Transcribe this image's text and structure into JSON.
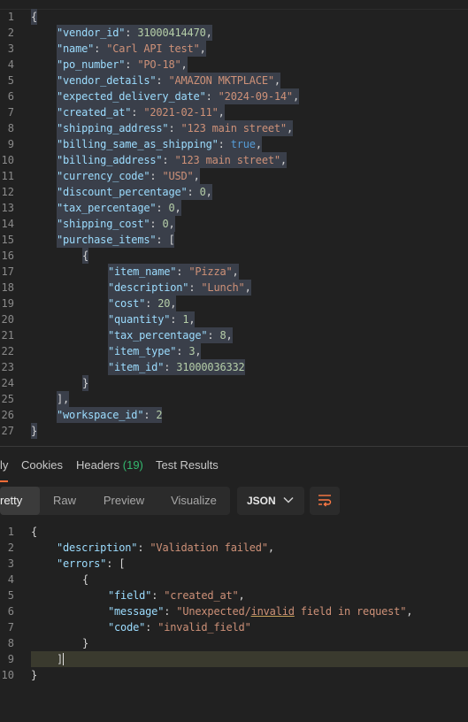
{
  "request_body": {
    "lines": [
      {
        "num": "1",
        "tokens": [
          [
            "p",
            "{"
          ]
        ]
      },
      {
        "num": "2",
        "tokens": [
          [
            "k",
            "\"vendor_id\""
          ],
          [
            "p",
            ": "
          ],
          [
            "n",
            "31000414470"
          ],
          [
            "p",
            ","
          ]
        ]
      },
      {
        "num": "3",
        "tokens": [
          [
            "k",
            "\"name\""
          ],
          [
            "p",
            ": "
          ],
          [
            "s",
            "\"Carl API test\""
          ],
          [
            "p",
            ","
          ]
        ]
      },
      {
        "num": "4",
        "tokens": [
          [
            "k",
            "\"po_number\""
          ],
          [
            "p",
            ": "
          ],
          [
            "s",
            "\"PO-18\""
          ],
          [
            "p",
            ","
          ]
        ]
      },
      {
        "num": "5",
        "tokens": [
          [
            "k",
            "\"vendor_details\""
          ],
          [
            "p",
            ": "
          ],
          [
            "s",
            "\"AMAZON MKTPLACE\""
          ],
          [
            "p",
            ","
          ]
        ]
      },
      {
        "num": "6",
        "tokens": [
          [
            "k",
            "\"expected_delivery_date\""
          ],
          [
            "p",
            ": "
          ],
          [
            "s",
            "\"2024-09-14\""
          ],
          [
            "p",
            ","
          ]
        ]
      },
      {
        "num": "7",
        "tokens": [
          [
            "k",
            "\"created_at\""
          ],
          [
            "p",
            ": "
          ],
          [
            "s",
            "\"2021-02-11\""
          ],
          [
            "p",
            ","
          ]
        ]
      },
      {
        "num": "8",
        "tokens": [
          [
            "k",
            "\"shipping_address\""
          ],
          [
            "p",
            ": "
          ],
          [
            "s",
            "\"123 main street\""
          ],
          [
            "p",
            ","
          ]
        ]
      },
      {
        "num": "9",
        "tokens": [
          [
            "k",
            "\"billing_same_as_shipping\""
          ],
          [
            "p",
            ": "
          ],
          [
            "b",
            "true"
          ],
          [
            "p",
            ","
          ]
        ]
      },
      {
        "num": "10",
        "tokens": [
          [
            "k",
            "\"billing_address\""
          ],
          [
            "p",
            ": "
          ],
          [
            "s",
            "\"123 main street\""
          ],
          [
            "p",
            ","
          ]
        ]
      },
      {
        "num": "11",
        "tokens": [
          [
            "k",
            "\"currency_code\""
          ],
          [
            "p",
            ": "
          ],
          [
            "s",
            "\"USD\""
          ],
          [
            "p",
            ","
          ]
        ]
      },
      {
        "num": "12",
        "tokens": [
          [
            "k",
            "\"discount_percentage\""
          ],
          [
            "p",
            ": "
          ],
          [
            "n",
            "0"
          ],
          [
            "p",
            ","
          ]
        ]
      },
      {
        "num": "13",
        "tokens": [
          [
            "k",
            "\"tax_percentage\""
          ],
          [
            "p",
            ": "
          ],
          [
            "n",
            "0"
          ],
          [
            "p",
            ","
          ]
        ]
      },
      {
        "num": "14",
        "tokens": [
          [
            "k",
            "\"shipping_cost\""
          ],
          [
            "p",
            ": "
          ],
          [
            "n",
            "0"
          ],
          [
            "p",
            ","
          ]
        ]
      },
      {
        "num": "15",
        "tokens": [
          [
            "k",
            "\"purchase_items\""
          ],
          [
            "p",
            ": ["
          ]
        ]
      },
      {
        "num": "16",
        "tokens": [
          [
            "p",
            "{"
          ]
        ]
      },
      {
        "num": "17",
        "tokens": [
          [
            "k",
            "\"item_name\""
          ],
          [
            "p",
            ": "
          ],
          [
            "s",
            "\"Pizza\""
          ],
          [
            "p",
            ","
          ]
        ]
      },
      {
        "num": "18",
        "tokens": [
          [
            "k",
            "\"description\""
          ],
          [
            "p",
            ": "
          ],
          [
            "s",
            "\"Lunch\""
          ],
          [
            "p",
            ","
          ]
        ]
      },
      {
        "num": "19",
        "tokens": [
          [
            "k",
            "\"cost\""
          ],
          [
            "p",
            ": "
          ],
          [
            "n",
            "20"
          ],
          [
            "p",
            ","
          ]
        ]
      },
      {
        "num": "20",
        "tokens": [
          [
            "k",
            "\"quantity\""
          ],
          [
            "p",
            ": "
          ],
          [
            "n",
            "1"
          ],
          [
            "p",
            ","
          ]
        ]
      },
      {
        "num": "21",
        "tokens": [
          [
            "k",
            "\"tax_percentage\""
          ],
          [
            "p",
            ": "
          ],
          [
            "n",
            "8"
          ],
          [
            "p",
            ","
          ]
        ]
      },
      {
        "num": "22",
        "tokens": [
          [
            "k",
            "\"item_type\""
          ],
          [
            "p",
            ": "
          ],
          [
            "n",
            "3"
          ],
          [
            "p",
            ","
          ]
        ]
      },
      {
        "num": "23",
        "tokens": [
          [
            "k",
            "\"item_id\""
          ],
          [
            "p",
            ": "
          ],
          [
            "n",
            "31000036332"
          ]
        ]
      },
      {
        "num": "24",
        "tokens": [
          [
            "p",
            "}"
          ]
        ]
      },
      {
        "num": "25",
        "tokens": [
          [
            "p",
            "],"
          ]
        ]
      },
      {
        "num": "26",
        "tokens": [
          [
            "k",
            "\"workspace_id\""
          ],
          [
            "p",
            ": "
          ],
          [
            "n",
            "2"
          ]
        ]
      },
      {
        "num": "27",
        "tokens": [
          [
            "p",
            "}"
          ]
        ]
      }
    ]
  },
  "response_tabs": {
    "body": "ly",
    "cookies": "Cookies",
    "headers": "Headers",
    "headers_count": "(19)",
    "test_results": "Test Results"
  },
  "view_modes": {
    "pretty": "retty",
    "raw": "Raw",
    "preview": "Preview",
    "visualize": "Visualize",
    "format": "JSON",
    "active": "Pretty"
  },
  "response_body": {
    "lines": [
      {
        "num": "1",
        "tokens": [
          [
            "p",
            "{"
          ]
        ]
      },
      {
        "num": "2",
        "tokens": [
          [
            "k",
            "\"description\""
          ],
          [
            "p",
            ": "
          ],
          [
            "s",
            "\"Validation failed\""
          ],
          [
            "p",
            ","
          ]
        ]
      },
      {
        "num": "3",
        "tokens": [
          [
            "k",
            "\"errors\""
          ],
          [
            "p",
            ": "
          ],
          [
            "p",
            "["
          ]
        ]
      },
      {
        "num": "4",
        "tokens": [
          [
            "p",
            "{"
          ]
        ]
      },
      {
        "num": "5",
        "tokens": [
          [
            "k",
            "\"field\""
          ],
          [
            "p",
            ": "
          ],
          [
            "s",
            "\"created_at\""
          ],
          [
            "p",
            ","
          ]
        ]
      },
      {
        "num": "6",
        "tokens": [
          [
            "k",
            "\"message\""
          ],
          [
            "p",
            ": "
          ],
          [
            "s",
            "\"Unexpected/invalid field in request\""
          ],
          [
            "p",
            ","
          ]
        ]
      },
      {
        "num": "7",
        "tokens": [
          [
            "k",
            "\"code\""
          ],
          [
            "p",
            ": "
          ],
          [
            "s",
            "\"invalid_field\""
          ]
        ]
      },
      {
        "num": "8",
        "tokens": [
          [
            "p",
            "}"
          ]
        ]
      },
      {
        "num": "9",
        "tokens": [
          [
            "p",
            "]"
          ]
        ]
      },
      {
        "num": "10",
        "tokens": [
          [
            "p",
            "}"
          ]
        ]
      }
    ]
  },
  "colors": {
    "background": "#212121",
    "key": "#9cdcfe",
    "string": "#ce9178",
    "number": "#b5cea8",
    "boolean": "#569cd6",
    "selection": "#3a3f4a",
    "headers_count": "#34b96e"
  }
}
